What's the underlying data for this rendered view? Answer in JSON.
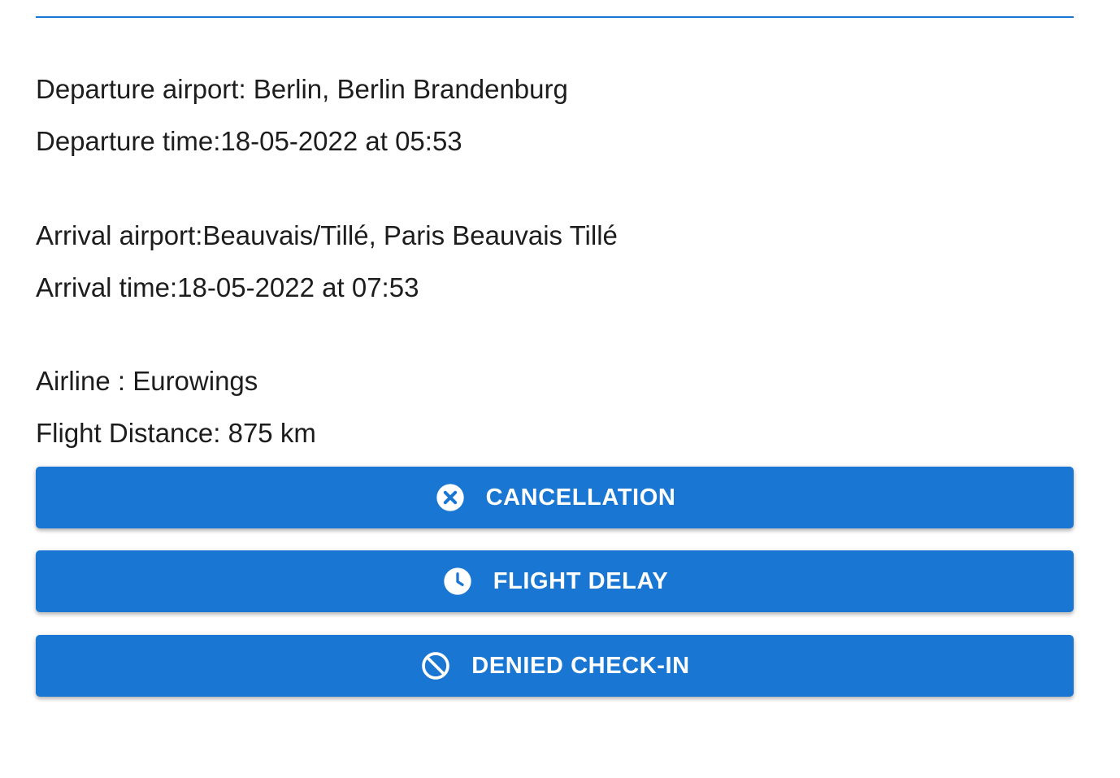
{
  "flight": {
    "departure_airport": "Departure airport: Berlin, Berlin Brandenburg",
    "departure_time": "Departure time:18-05-2022 at 05:53",
    "arrival_airport": "Arrival airport:Beauvais/Tillé, Paris Beauvais Tillé",
    "arrival_time": "Arrival time:18-05-2022 at 07:53",
    "airline": "Airline : Eurowings",
    "flight_distance": "Flight Distance: 875 km"
  },
  "actions": {
    "cancellation": {
      "label": "CANCELLATION",
      "icon": "cancel-circle-icon"
    },
    "flight_delay": {
      "label": "FLIGHT DELAY",
      "icon": "clock-icon"
    },
    "denied_checkin": {
      "label": "DENIED CHECK-IN",
      "icon": "block-icon"
    }
  },
  "colors": {
    "accent": "#1976d2",
    "text": "#1d1d1d",
    "button_text": "#ffffff"
  }
}
